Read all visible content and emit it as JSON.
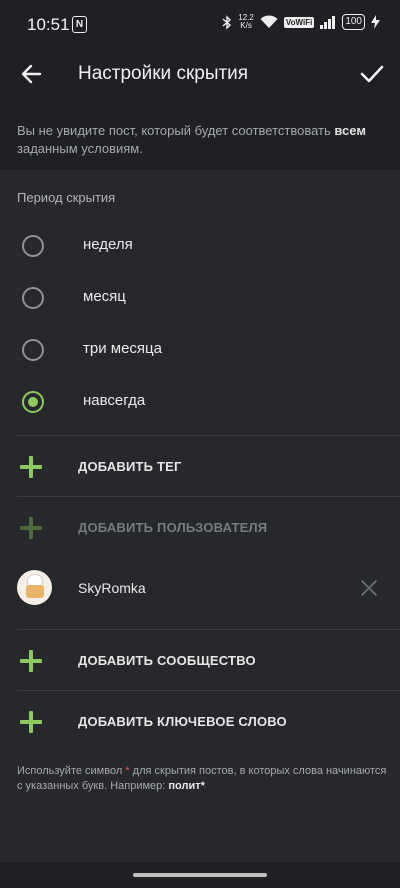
{
  "status_bar": {
    "time": "10:51",
    "nfc_icon": "N",
    "speed_value": "12.2",
    "speed_unit": "K/s",
    "vowifi": "VoWiFi",
    "battery": "100"
  },
  "header": {
    "title": "Настройки скрытия"
  },
  "notice": {
    "text_before": "Вы не увидите пост, который будет соответствовать ",
    "text_bold": "всем",
    "text_after": " заданным условиям."
  },
  "period": {
    "label": "Период скрытия",
    "options": [
      {
        "label": "неделя",
        "selected": false
      },
      {
        "label": "месяц",
        "selected": false
      },
      {
        "label": "три месяца",
        "selected": false
      },
      {
        "label": "навсегда",
        "selected": true
      }
    ]
  },
  "actions": {
    "add_tag": "ДОБАВИТЬ ТЕГ",
    "add_user": "ДОБАВИТЬ ПОЛЬЗОВАТЕЛЯ",
    "add_community": "ДОБАВИТЬ СООБЩЕСТВО",
    "add_keyword": "ДОБАВИТЬ КЛЮЧЕВОЕ СЛОВО"
  },
  "user": {
    "name": "SkyRomka"
  },
  "hint": {
    "part1": "Используйте символ ",
    "star": "*",
    "part2": " для скрытия постов, в которых слова начинаются с указанных букв. Например: ",
    "example": "полит*"
  },
  "colors": {
    "accent": "#8fc861",
    "background": "#26282b",
    "surface": "#1e2023",
    "star": "#e0574f"
  }
}
